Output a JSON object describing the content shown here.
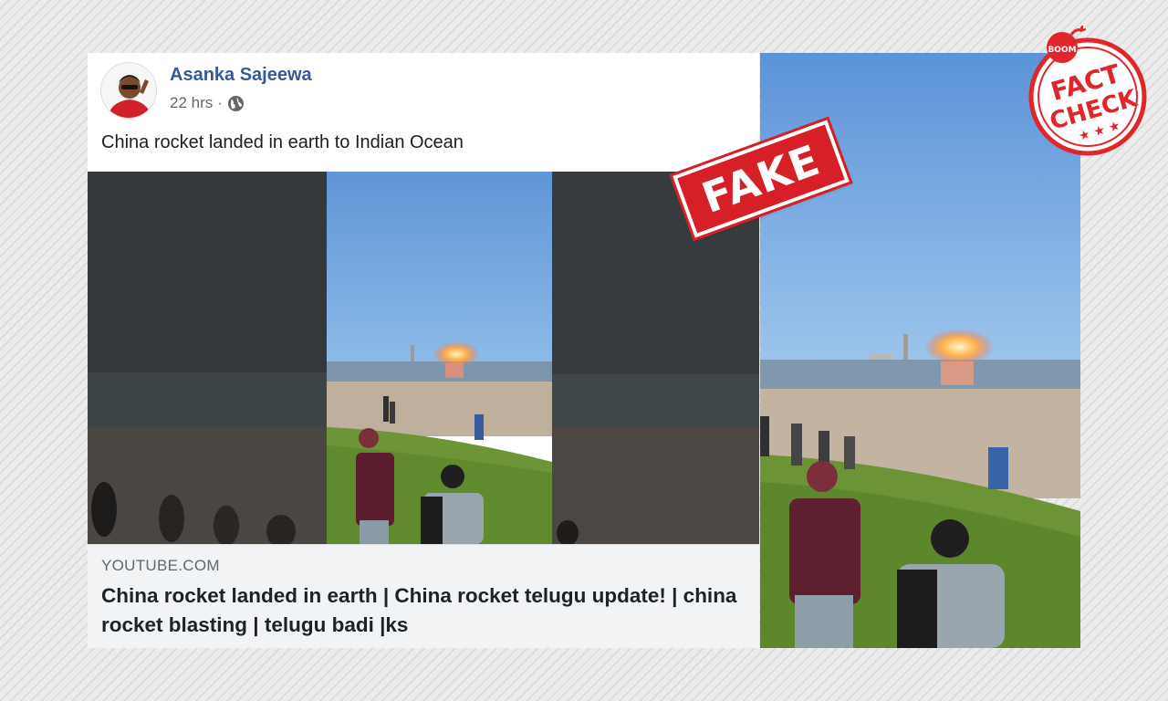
{
  "post": {
    "author": "Asanka Sajeewa",
    "time": "22 hrs",
    "separator": "·",
    "privacy_icon": "globe-icon",
    "text": "China rocket landed in earth to Indian Ocean",
    "link": {
      "domain": "YOUTUBE.COM",
      "title": "China rocket landed in earth | China rocket telugu update! | china rocket blasting | telugu badi |ks"
    }
  },
  "overlay": {
    "stamp_text": "FAKE",
    "seal": {
      "brand": "BOOM",
      "line1": "FACT",
      "line2": "CHECK"
    }
  },
  "colors": {
    "facebook_link_blue": "#385898",
    "stamp_red": "#d61f26",
    "link_preview_bg": "#f2f3f5"
  }
}
